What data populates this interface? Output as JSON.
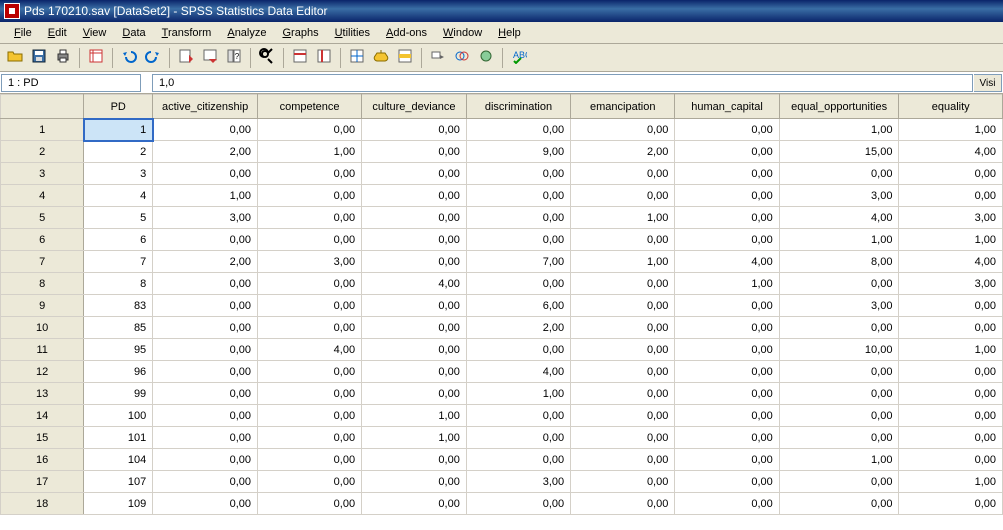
{
  "title": "Pds 170210.sav [DataSet2] - SPSS Statistics Data Editor",
  "menu": [
    "File",
    "Edit",
    "View",
    "Data",
    "Transform",
    "Analyze",
    "Graphs",
    "Utilities",
    "Add-ons",
    "Window",
    "Help"
  ],
  "cellref": "1 : PD",
  "cellval": "1,0",
  "tail": "Visi",
  "columns": [
    "PD",
    "active_citizenship",
    "competence",
    "culture_deviance",
    "discrimination",
    "emancipation",
    "human_capital",
    "equal_opportunities",
    "equality"
  ],
  "row_labels": [
    "1",
    "2",
    "3",
    "4",
    "5",
    "6",
    "7",
    "8",
    "9",
    "10",
    "11",
    "12",
    "13",
    "14",
    "15",
    "16",
    "17",
    "18"
  ],
  "rows": [
    [
      "1",
      "0,00",
      "0,00",
      "0,00",
      "0,00",
      "0,00",
      "0,00",
      "1,00",
      "1,00"
    ],
    [
      "2",
      "2,00",
      "1,00",
      "0,00",
      "9,00",
      "2,00",
      "0,00",
      "15,00",
      "4,00"
    ],
    [
      "3",
      "0,00",
      "0,00",
      "0,00",
      "0,00",
      "0,00",
      "0,00",
      "0,00",
      "0,00"
    ],
    [
      "4",
      "1,00",
      "0,00",
      "0,00",
      "0,00",
      "0,00",
      "0,00",
      "3,00",
      "0,00"
    ],
    [
      "5",
      "3,00",
      "0,00",
      "0,00",
      "0,00",
      "1,00",
      "0,00",
      "4,00",
      "3,00"
    ],
    [
      "6",
      "0,00",
      "0,00",
      "0,00",
      "0,00",
      "0,00",
      "0,00",
      "1,00",
      "1,00"
    ],
    [
      "7",
      "2,00",
      "3,00",
      "0,00",
      "7,00",
      "1,00",
      "4,00",
      "8,00",
      "4,00"
    ],
    [
      "8",
      "0,00",
      "0,00",
      "4,00",
      "0,00",
      "0,00",
      "1,00",
      "0,00",
      "3,00"
    ],
    [
      "83",
      "0,00",
      "0,00",
      "0,00",
      "6,00",
      "0,00",
      "0,00",
      "3,00",
      "0,00"
    ],
    [
      "85",
      "0,00",
      "0,00",
      "0,00",
      "2,00",
      "0,00",
      "0,00",
      "0,00",
      "0,00"
    ],
    [
      "95",
      "0,00",
      "4,00",
      "0,00",
      "0,00",
      "0,00",
      "0,00",
      "10,00",
      "1,00"
    ],
    [
      "96",
      "0,00",
      "0,00",
      "0,00",
      "4,00",
      "0,00",
      "0,00",
      "0,00",
      "0,00"
    ],
    [
      "99",
      "0,00",
      "0,00",
      "0,00",
      "1,00",
      "0,00",
      "0,00",
      "0,00",
      "0,00"
    ],
    [
      "100",
      "0,00",
      "0,00",
      "1,00",
      "0,00",
      "0,00",
      "0,00",
      "0,00",
      "0,00"
    ],
    [
      "101",
      "0,00",
      "0,00",
      "1,00",
      "0,00",
      "0,00",
      "0,00",
      "0,00",
      "0,00"
    ],
    [
      "104",
      "0,00",
      "0,00",
      "0,00",
      "0,00",
      "0,00",
      "0,00",
      "1,00",
      "0,00"
    ],
    [
      "107",
      "0,00",
      "0,00",
      "0,00",
      "3,00",
      "0,00",
      "0,00",
      "0,00",
      "1,00"
    ],
    [
      "109",
      "0,00",
      "0,00",
      "0,00",
      "0,00",
      "0,00",
      "0,00",
      "0,00",
      "0,00"
    ]
  ],
  "selected": {
    "row": 0,
    "col": 0
  },
  "icons": {
    "open": "open-icon",
    "save": "save-icon",
    "print": "print-icon",
    "recent": "recent-icon",
    "undo": "undo-icon",
    "redo": "redo-icon",
    "goto": "goto-case-icon",
    "gotovar": "goto-var-icon",
    "vars": "variables-icon",
    "find": "find-icon",
    "insert-case": "insert-case-icon",
    "insert-var": "insert-var-icon",
    "split": "split-file-icon",
    "weight": "weight-cases-icon",
    "select": "select-cases-icon",
    "valuelabels": "value-labels-icon",
    "usesets": "use-sets-icon",
    "showall": "show-all-icon",
    "spell": "spellcheck-icon"
  }
}
